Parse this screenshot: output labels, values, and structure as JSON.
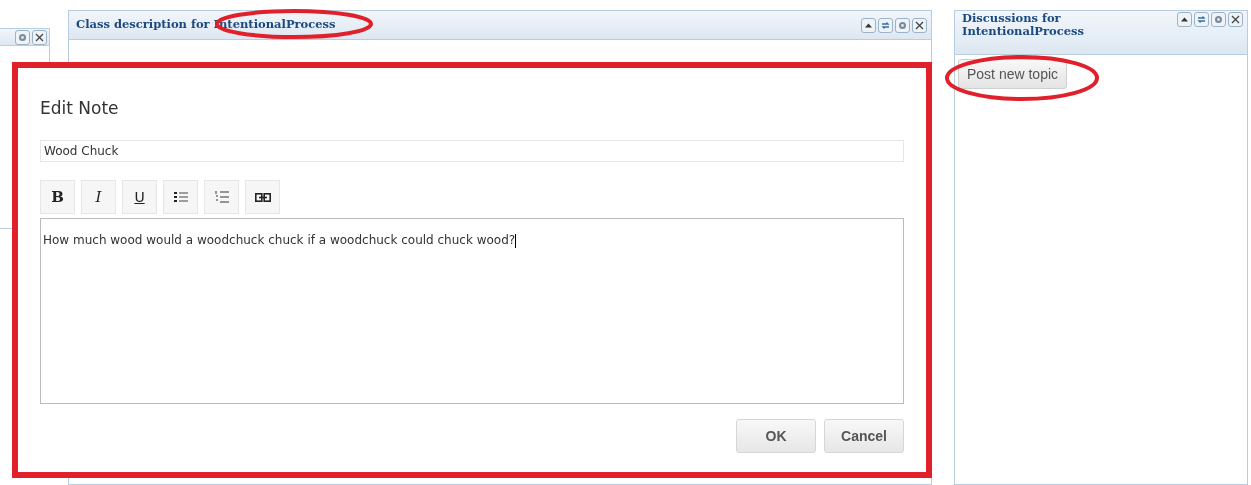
{
  "left_panel": {
    "buttons": [
      {
        "kind": "settings"
      },
      {
        "kind": "close"
      }
    ]
  },
  "class_panel": {
    "title": "Class description for IntentionalProcess",
    "buttons": [
      {
        "kind": "collapse"
      },
      {
        "kind": "refresh"
      },
      {
        "kind": "settings"
      },
      {
        "kind": "close"
      }
    ]
  },
  "discussions_panel": {
    "title": "Discussions for IntentionalProcess",
    "buttons": [
      {
        "kind": "collapse"
      },
      {
        "kind": "refresh"
      },
      {
        "kind": "settings"
      },
      {
        "kind": "close"
      }
    ],
    "post_button": "Post new topic"
  },
  "dialog": {
    "title": "Edit Note",
    "subject": {
      "value": "Wood Chuck"
    },
    "toolbar": [
      {
        "kind": "bold",
        "label": "B"
      },
      {
        "kind": "italic",
        "label": "I"
      },
      {
        "kind": "underline",
        "label": "U"
      },
      {
        "kind": "bullet-list"
      },
      {
        "kind": "numbered-list"
      },
      {
        "kind": "link"
      }
    ],
    "body": {
      "value": "How much wood would a woodchuck chuck if a woodchuck could chuck wood?"
    },
    "buttons": [
      "OK",
      "Cancel"
    ]
  }
}
